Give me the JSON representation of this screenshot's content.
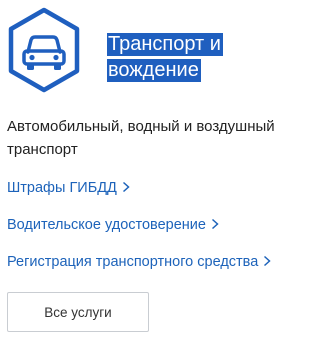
{
  "category": {
    "icon": "car-icon",
    "accent_color": "#1f5fbf",
    "link_color": "#1d63ba",
    "title_line1": "Транспорт и",
    "title_line2": "вождение",
    "description": "Автомобильный, водный и воздушный транспорт"
  },
  "links": [
    {
      "label": "Штрафы ГИБДД",
      "icon": "chevron-right-icon"
    },
    {
      "label": "Водительское удостоверение",
      "icon": "chevron-right-icon"
    },
    {
      "label": "Регистрация транспортного средства",
      "icon": "chevron-right-icon"
    }
  ],
  "all_services_button": {
    "label": "Все услуги"
  }
}
